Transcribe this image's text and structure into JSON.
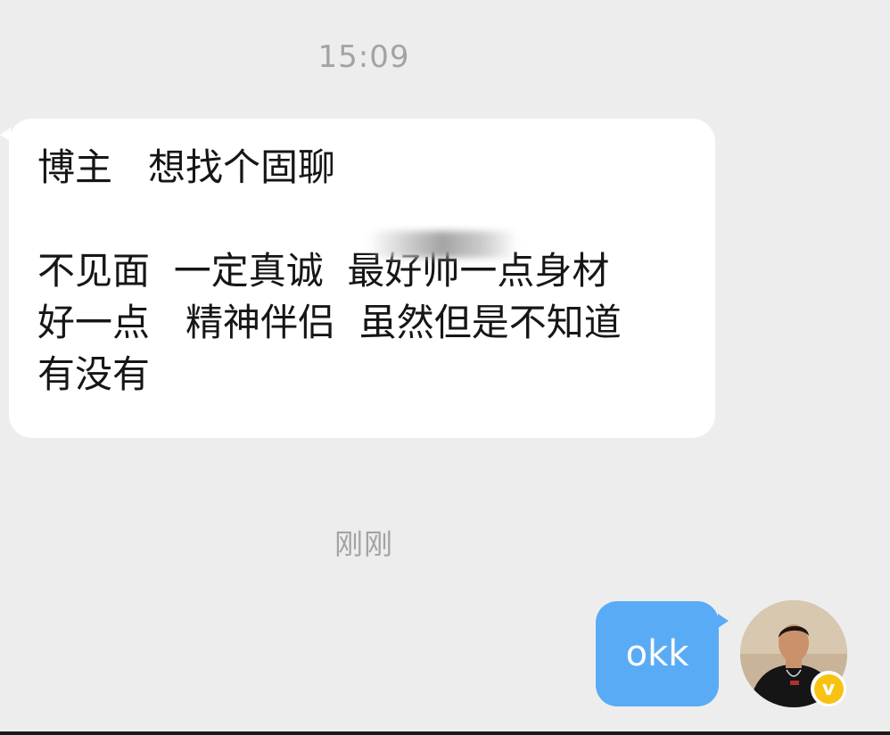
{
  "chat": {
    "time_first": "15:09",
    "time_second": "刚刚",
    "incoming_message": {
      "lines": [
        "博主   想找个固聊",
        "不见面  一定真诚  最好帅一点身材",
        "好一点   精神伴侣  虽然但是不知道",
        "有没有"
      ]
    },
    "outgoing_message": {
      "text": "okk"
    },
    "avatar": {
      "badge_text": "v"
    }
  },
  "colors": {
    "background": "#ededed",
    "incoming_bubble": "#ffffff",
    "outgoing_bubble": "#5aabf5",
    "timestamp": "#a3a3a3",
    "verified_badge": "#f7c212"
  }
}
